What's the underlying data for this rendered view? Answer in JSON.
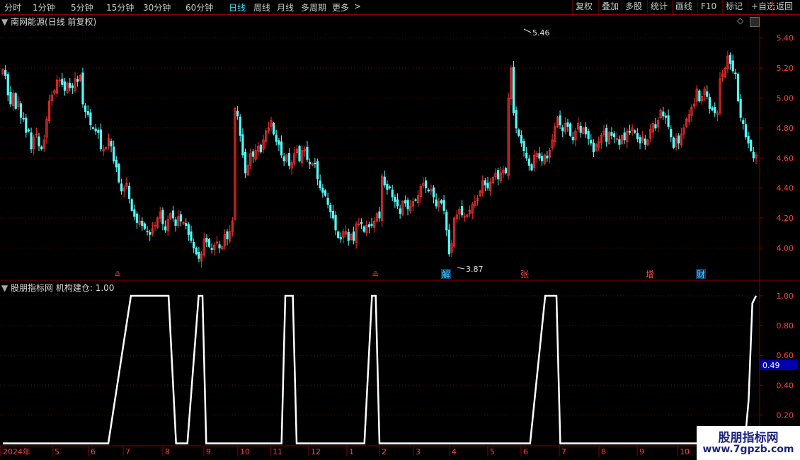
{
  "toolbar": {
    "periods": [
      {
        "label": "分时",
        "active": false
      },
      {
        "label": "1分钟",
        "active": false
      },
      {
        "label": "5分钟",
        "active": false
      },
      {
        "label": "15分钟",
        "active": false
      },
      {
        "label": "30分钟",
        "active": false
      },
      {
        "label": "60分钟",
        "active": false
      },
      {
        "label": "日线",
        "active": true
      },
      {
        "label": "周线",
        "active": false
      },
      {
        "label": "月线",
        "active": false
      },
      {
        "label": "多周期",
        "active": false
      },
      {
        "label": "更多",
        "active": false
      }
    ],
    "more_arrow": ">",
    "right_buttons": [
      "复权",
      "叠加",
      "多股",
      "统计",
      "画线",
      "F10",
      "标记",
      "+自选",
      "返回"
    ]
  },
  "stock": {
    "title": "南网能源(日线 前复权)",
    "high_label": "5.46",
    "low_label": "3.87",
    "events": [
      {
        "text": "≗",
        "color": "#e03030"
      },
      {
        "text": "≗",
        "color": "#e03030"
      },
      {
        "text": "解",
        "color": "#2fd9ff"
      },
      {
        "text": "张",
        "color": "#ff5050"
      },
      {
        "text": "增",
        "color": "#ff5050"
      },
      {
        "text": "财",
        "color": "#2fd9ff"
      }
    ]
  },
  "indicator": {
    "title": "股朋指标网 机构建仓: 1.00",
    "current_value": "0.49",
    "signal": [
      [
        0,
        0
      ],
      [
        0.14,
        0
      ],
      [
        0.17,
        1
      ],
      [
        0.22,
        1
      ],
      [
        0.23,
        0
      ],
      [
        0.245,
        0
      ],
      [
        0.26,
        1
      ],
      [
        0.265,
        1
      ],
      [
        0.27,
        0
      ],
      [
        0.28,
        0
      ],
      [
        0.295,
        0
      ],
      [
        0.37,
        0
      ],
      [
        0.375,
        1
      ],
      [
        0.385,
        1
      ],
      [
        0.39,
        0
      ],
      [
        0.48,
        0
      ],
      [
        0.49,
        1
      ],
      [
        0.495,
        1
      ],
      [
        0.5,
        0
      ],
      [
        0.66,
        0
      ],
      [
        0.7,
        0
      ],
      [
        0.72,
        1
      ],
      [
        0.735,
        1
      ],
      [
        0.74,
        0
      ],
      [
        0.84,
        0
      ],
      [
        0.985,
        0
      ],
      [
        0.99,
        0.3
      ],
      [
        0.995,
        0.95
      ],
      [
        1,
        1
      ]
    ]
  },
  "price_axis": [
    "5.40",
    "5.20",
    "5.00",
    "4.80",
    "4.60",
    "4.40",
    "4.20",
    "4.00"
  ],
  "indicator_axis": [
    "1.00",
    "0.80",
    "0.60",
    "0.40",
    "0.20"
  ],
  "time_axis": [
    "2024年",
    "5",
    "6",
    "7",
    "8",
    "9",
    "10",
    "11",
    "12",
    "1",
    "2",
    "3",
    "4",
    "5",
    "6",
    "7",
    "8",
    "9",
    "10"
  ],
  "colors": {
    "up": "#ff3232",
    "down": "#54fcfc",
    "grid": "#7a0000",
    "line": "#ffffff"
  },
  "chart_data": {
    "type": "candlestick",
    "price_range": [
      3.87,
      5.46
    ],
    "close_series": [
      5.19,
      5.15,
      5.02,
      4.96,
      5.03,
      4.93,
      4.98,
      4.87,
      4.86,
      4.77,
      4.78,
      4.66,
      4.74,
      4.76,
      4.68,
      4.66,
      4.72,
      4.86,
      4.98,
      5.02,
      5.05,
      5.12,
      5.12,
      5.09,
      5.05,
      5.1,
      5.07,
      5.07,
      5.13,
      5.11,
      5.15,
      4.96,
      4.91,
      4.89,
      4.82,
      4.8,
      4.78,
      4.77,
      4.66,
      4.66,
      4.67,
      4.73,
      4.68,
      4.58,
      4.54,
      4.44,
      4.38,
      4.4,
      4.43,
      4.33,
      4.25,
      4.21,
      4.17,
      4.18,
      4.15,
      4.13,
      4.11,
      4.09,
      4.13,
      4.15,
      4.2,
      4.24,
      4.16,
      4.12,
      4.19,
      4.23,
      4.2,
      4.15,
      4.21,
      4.18,
      4.17,
      4.15,
      4.09,
      4.05,
      4.0,
      3.96,
      3.93,
      3.96,
      4.06,
      4.04,
      4.01,
      3.99,
      4.02,
      4.04,
      4.0,
      4.01,
      4.09,
      4.06,
      4.11,
      4.18,
      4.93,
      4.88,
      4.75,
      4.62,
      4.5,
      4.55,
      4.63,
      4.61,
      4.65,
      4.68,
      4.64,
      4.72,
      4.78,
      4.8,
      4.85,
      4.76,
      4.71,
      4.69,
      4.62,
      4.58,
      4.62,
      4.55,
      4.57,
      4.63,
      4.66,
      4.58,
      4.65,
      4.66,
      4.59,
      4.56,
      4.56,
      4.56,
      4.46,
      4.4,
      4.37,
      4.35,
      4.29,
      4.24,
      4.2,
      4.12,
      4.07,
      4.06,
      4.11,
      4.11,
      4.05,
      4.09,
      4.05,
      4.16,
      4.16,
      4.16,
      4.11,
      4.15,
      4.14,
      4.15,
      4.18,
      4.23,
      4.2,
      4.48,
      4.42,
      4.39,
      4.4,
      4.34,
      4.31,
      4.28,
      4.23,
      4.31,
      4.3,
      4.26,
      4.28,
      4.31,
      4.32,
      4.35,
      4.41,
      4.43,
      4.4,
      4.38,
      4.39,
      4.34,
      4.28,
      4.31,
      4.3,
      4.25,
      4.12,
      3.96,
      4.03,
      4.2,
      4.22,
      4.26,
      4.22,
      4.21,
      4.22,
      4.25,
      4.29,
      4.31,
      4.33,
      4.38,
      4.45,
      4.42,
      4.4,
      4.44,
      4.47,
      4.5,
      4.46,
      4.5,
      4.52,
      4.5,
      5.0,
      5.2,
      4.9,
      4.8,
      4.75,
      4.7,
      4.65,
      4.6,
      4.55,
      4.52,
      4.62,
      4.63,
      4.6,
      4.58,
      4.62,
      4.6,
      4.65,
      4.72,
      4.81,
      4.87,
      4.82,
      4.78,
      4.83,
      4.81,
      4.75,
      4.72,
      4.78,
      4.83,
      4.77,
      4.8,
      4.76,
      4.73,
      4.7,
      4.64,
      4.69,
      4.71,
      4.75,
      4.78,
      4.71,
      4.77,
      4.75,
      4.74,
      4.73,
      4.69,
      4.75,
      4.72,
      4.78,
      4.77,
      4.8,
      4.77,
      4.73,
      4.7,
      4.74,
      4.69,
      4.72,
      4.79,
      4.83,
      4.8,
      4.85,
      4.92,
      4.88,
      4.87,
      4.81,
      4.74,
      4.67,
      4.73,
      4.7,
      4.76,
      4.8,
      4.86,
      4.89,
      4.94,
      4.96,
      5.06,
      4.98,
      5.01,
      5.06,
      5.01,
      4.93,
      4.92,
      4.9,
      4.9,
      5.13,
      5.16,
      5.2,
      5.28,
      5.23,
      5.18,
      5.16,
      4.98,
      4.87,
      4.83,
      4.74,
      4.7,
      4.65,
      4.6,
      4.62
    ]
  }
}
